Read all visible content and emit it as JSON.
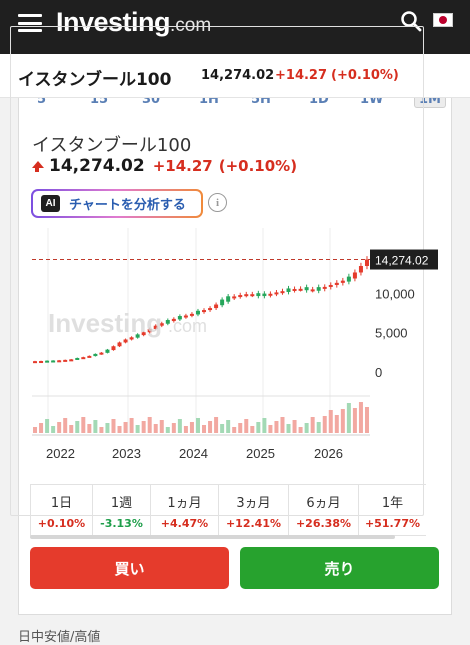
{
  "header": {
    "logo_main": "Investing",
    "logo_com": ".com"
  },
  "instrument": {
    "name": "イスタンブール100",
    "price": "14,274.02",
    "change": "+14.27",
    "change_pct": "(+0.10%)"
  },
  "intervals": [
    {
      "label": "5",
      "active": false
    },
    {
      "label": "15",
      "active": false
    },
    {
      "label": "30",
      "active": false
    },
    {
      "label": "1H",
      "active": false
    },
    {
      "label": "5H",
      "active": false
    },
    {
      "label": "1D",
      "active": false
    },
    {
      "label": "1W",
      "active": false
    },
    {
      "label": "1M",
      "active": true
    }
  ],
  "ai_button": {
    "badge": "AI",
    "label": "チャートを分析する"
  },
  "info_icon_glyph": "i",
  "colors": {
    "up": "#d62e1f",
    "down": "#1e9e4a",
    "buy": "#e53b2c",
    "sell": "#27a22e",
    "candle_up": "#26a65b",
    "candle_down": "#e53b2c"
  },
  "chart_data": {
    "type": "candlestick",
    "y_ticks": [
      "10,000",
      "5,000",
      "0"
    ],
    "x_ticks": [
      "2022",
      "2023",
      "2024",
      "2025",
      "2026"
    ],
    "last_price_label": "14,274.02",
    "ylim": [
      -2000,
      17000
    ],
    "series": {
      "dates": [
        "2021-09",
        "2021-12",
        "2022-03",
        "2022-06",
        "2022-09",
        "2022-12",
        "2023-03",
        "2023-06",
        "2023-09",
        "2023-12",
        "2024-03",
        "2024-06",
        "2024-09",
        "2024-12",
        "2025-03",
        "2025-06",
        "2025-09",
        "2025-12",
        "2026-03",
        "2026-05"
      ],
      "close": [
        1400,
        1450,
        1600,
        2000,
        2600,
        4000,
        4800,
        6000,
        6800,
        7400,
        8100,
        9400,
        9900,
        9700,
        10200,
        10600,
        10400,
        11100,
        11900,
        14274
      ]
    },
    "volume_note": "volume bars below price"
  },
  "periods": [
    {
      "label": "1日",
      "value": "+0.10%",
      "dir": "up"
    },
    {
      "label": "1週",
      "value": "-3.13%",
      "dir": "down"
    },
    {
      "label": "1ヵ月",
      "value": "+4.47%",
      "dir": "up"
    },
    {
      "label": "3ヵ月",
      "value": "+12.41%",
      "dir": "up"
    },
    {
      "label": "6ヵ月",
      "value": "+26.38%",
      "dir": "up"
    },
    {
      "label": "1年",
      "value": "+51.77%",
      "dir": "up"
    }
  ],
  "buttons": {
    "buy": "買い",
    "sell": "売り"
  },
  "footer": {
    "label": "日中安値/高値"
  }
}
